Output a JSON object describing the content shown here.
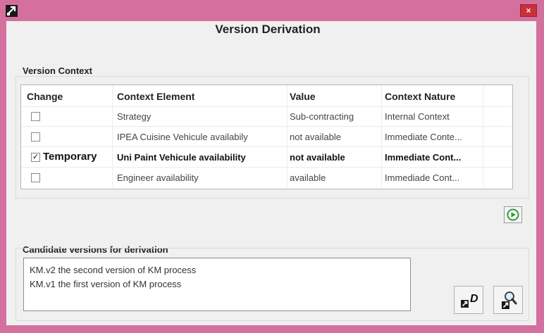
{
  "dialog": {
    "title": "Version Derivation",
    "close_glyph": "×",
    "app_icon": "kanban-app-icon",
    "accent_color": "#d4709e"
  },
  "version_context": {
    "label": "Version Context",
    "columns": [
      "Change",
      "Context Element",
      "Value",
      "Context Nature"
    ],
    "rows": [
      {
        "checked": false,
        "change_label": "",
        "element": "Strategy",
        "value": "Sub-contracting",
        "nature": "Internal Context",
        "bold": false
      },
      {
        "checked": false,
        "change_label": "",
        "element": "IPEA Cuisine Vehicule availabily",
        "value": "not available",
        "nature": "Immediate Conte...",
        "bold": false
      },
      {
        "checked": true,
        "change_label": "Temporary",
        "element": "Uni Paint Vehicule availability",
        "value": "not available",
        "nature": "Immediate Cont...",
        "bold": true
      },
      {
        "checked": false,
        "change_label": "",
        "element": "Engineer availability",
        "value": "available",
        "nature": "Immediade Cont...",
        "bold": false
      }
    ],
    "run_icon": "play-circle-icon"
  },
  "candidates": {
    "label": "Candidate versions for derivation",
    "items": [
      "KM.v2 the second version of KM process",
      "KM.v1 the first version of KM process"
    ],
    "derive_icon": "derive-version-icon",
    "inspect_icon": "inspect-version-icon",
    "derive_letter": "D"
  }
}
